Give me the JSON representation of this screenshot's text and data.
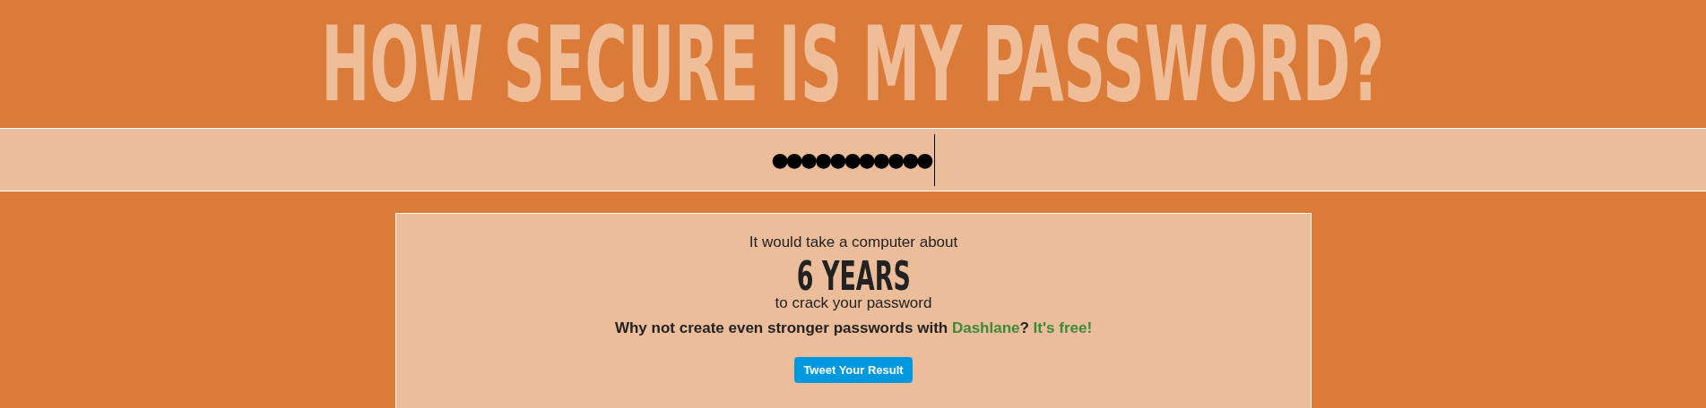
{
  "title": "HOW SECURE IS MY PASSWORD?",
  "password_field": {
    "value": "●●●●●●●●●●●",
    "focused": true
  },
  "result": {
    "intro": "It would take a computer about",
    "time": "6 YEARS",
    "outro": "to crack your password",
    "promo": [
      {
        "kind": "text",
        "text": "Why not create even stronger passwords with "
      },
      {
        "kind": "link",
        "text": "Dashlane"
      },
      {
        "kind": "text",
        "text": "? "
      },
      {
        "kind": "link",
        "text": "It's free!"
      }
    ],
    "button": "Tweet Your Result"
  }
}
